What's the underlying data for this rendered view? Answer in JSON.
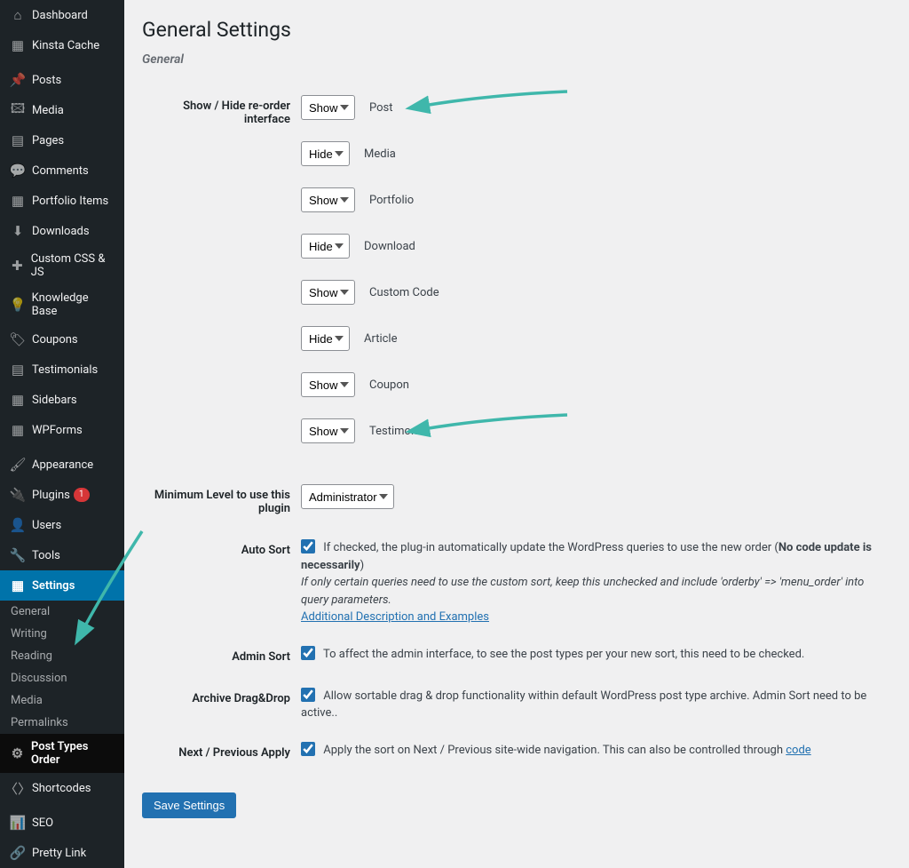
{
  "sidebar": {
    "items": [
      {
        "icon": "⌂",
        "label": "Dashboard"
      },
      {
        "icon": "▦",
        "label": "Kinsta Cache"
      },
      {
        "icon": "📌",
        "label": "Posts",
        "sep": true
      },
      {
        "icon": "🖾",
        "label": "Media"
      },
      {
        "icon": "▤",
        "label": "Pages"
      },
      {
        "icon": "💬",
        "label": "Comments"
      },
      {
        "icon": "▦",
        "label": "Portfolio Items"
      },
      {
        "icon": "⬇",
        "label": "Downloads"
      },
      {
        "icon": "✚",
        "label": "Custom CSS & JS"
      },
      {
        "icon": "💡",
        "label": "Knowledge Base"
      },
      {
        "icon": "🏷",
        "label": "Coupons"
      },
      {
        "icon": "▤",
        "label": "Testimonials"
      },
      {
        "icon": "▦",
        "label": "Sidebars"
      },
      {
        "icon": "▦",
        "label": "WPForms"
      },
      {
        "icon": "🖌",
        "label": "Appearance",
        "sep": true
      },
      {
        "icon": "🔌",
        "label": "Plugins",
        "badge": "1"
      },
      {
        "icon": "👤",
        "label": "Users"
      },
      {
        "icon": "🔧",
        "label": "Tools"
      },
      {
        "icon": "▦",
        "label": "Settings",
        "current": true
      },
      {
        "icon": "⚙",
        "label": "Post Types Order",
        "submenu_current": true
      },
      {
        "icon": "〈〉",
        "label": "Shortcodes"
      },
      {
        "icon": "📊",
        "label": "SEO",
        "sep": true
      },
      {
        "icon": "🔗",
        "label": "Pretty Link"
      }
    ],
    "submenu": [
      "General",
      "Writing",
      "Reading",
      "Discussion",
      "Media",
      "Permalinks"
    ]
  },
  "page": {
    "title": "General Settings",
    "section": "General",
    "label_showhide": "Show / Hide re-order interface",
    "post_types": [
      {
        "value": "Show",
        "label": "Post",
        "arrow": true
      },
      {
        "value": "Hide",
        "label": "Media"
      },
      {
        "value": "Show",
        "label": "Portfolio"
      },
      {
        "value": "Hide",
        "label": "Download"
      },
      {
        "value": "Show",
        "label": "Custom Code"
      },
      {
        "value": "Hide",
        "label": "Article"
      },
      {
        "value": "Show",
        "label": "Coupon"
      },
      {
        "value": "Show",
        "label": "Testimonial",
        "arrow": true
      }
    ],
    "label_minlevel": "Minimum Level to use this plugin",
    "minlevel_value": "Administrator",
    "label_autosort": "Auto Sort",
    "autosort_text_pre": "If checked, the plug-in automatically update the WordPress queries to use the new order (",
    "autosort_text_bold": "No code update is necessarily",
    "autosort_text_post": ")",
    "autosort_desc": "If only certain queries need to use the custom sort, keep this unchecked and include 'orderby'  =>  'menu_order' into query parameters.",
    "autosort_link": "Additional Description and Examples",
    "label_adminsort": "Admin Sort",
    "adminsort_text": "To affect the admin interface, to see the post types per your new sort, this need to be checked.",
    "label_archive": "Archive Drag&Drop",
    "archive_text": "Allow sortable drag & drop functionality within default WordPress post type archive. Admin Sort need to be active..",
    "label_nextprev": "Next / Previous Apply",
    "nextprev_text": "Apply the sort on Next / Previous site-wide navigation. This can also be controlled through ",
    "nextprev_link": "code",
    "save_button": "Save Settings"
  }
}
